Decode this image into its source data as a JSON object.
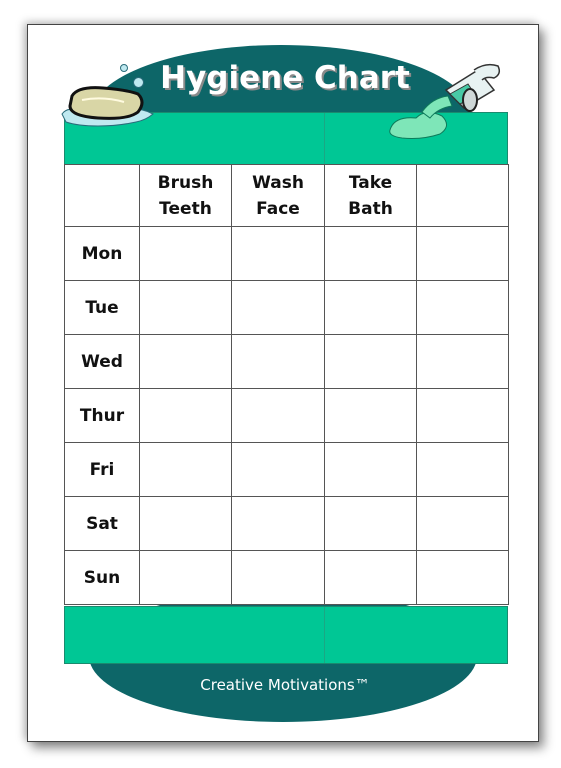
{
  "title": "Hygiene Chart",
  "footer": "Creative Motivations™",
  "columns": [
    "",
    "Brush\nTeeth",
    "Wash\nFace",
    "Take\nBath",
    ""
  ],
  "column_lines": [
    [
      "Brush",
      "Teeth"
    ],
    [
      "Wash",
      "Face"
    ],
    [
      "Take",
      "Bath"
    ]
  ],
  "days": [
    "Mon",
    "Tue",
    "Wed",
    "Thur",
    "Fri",
    "Sat",
    "Sun"
  ],
  "colors": {
    "dark_teal": "#0d6668",
    "band_green": "#00c795",
    "grid_line": "#555555"
  },
  "icons": [
    "soap-bar-icon",
    "toothpaste-tube-icon",
    "bubble-icon"
  ]
}
